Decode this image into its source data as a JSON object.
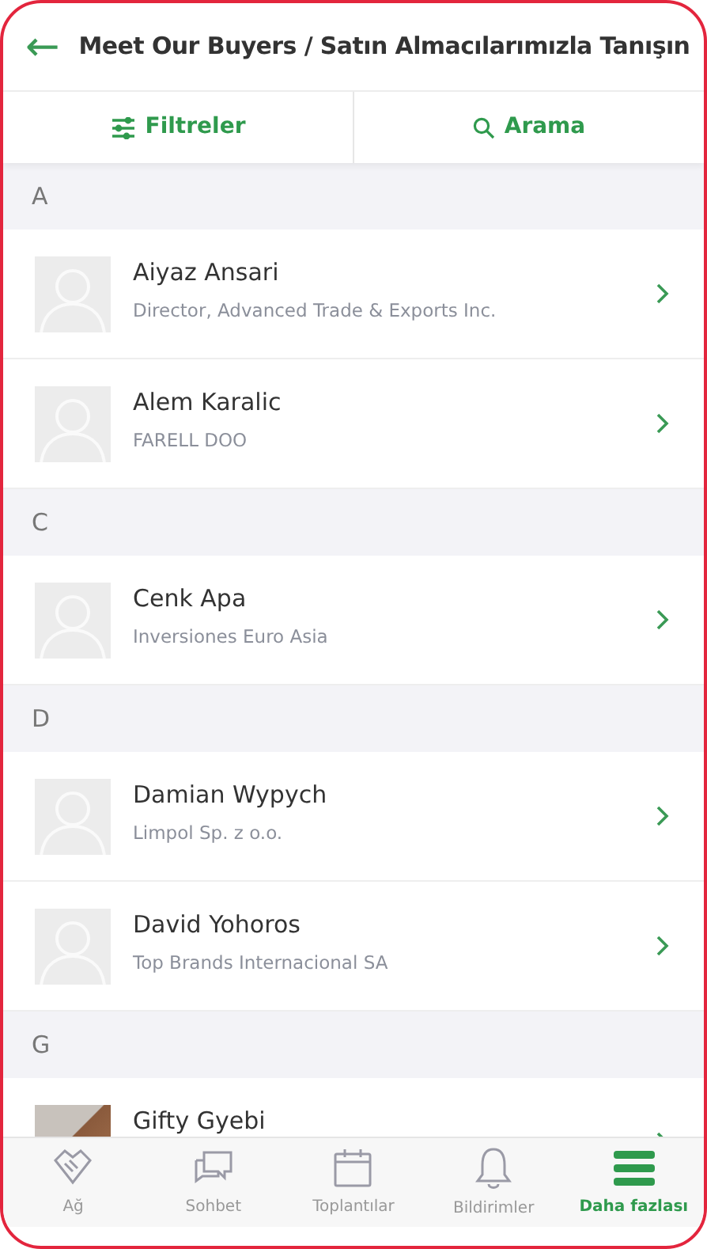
{
  "header": {
    "back": "←",
    "title": "Meet Our Buyers / Satın Almacılarımızla Tanışın"
  },
  "toolbar": [
    {
      "kind": "filter",
      "label": "Filtreler"
    },
    {
      "kind": "search",
      "label": "Arama"
    }
  ],
  "sections": [
    {
      "letter": "A",
      "contacts": [
        {
          "name": "Aiyaz Ansari",
          "subtitle": "Director, Advanced Trade & Exports Inc.",
          "kind": "placeholder"
        },
        {
          "name": "Alem Karalic",
          "subtitle": "FARELL DOO",
          "kind": "placeholder"
        }
      ]
    },
    {
      "letter": "C",
      "contacts": [
        {
          "name": "Cenk Apa",
          "subtitle": "Inversiones Euro Asia",
          "kind": "placeholder"
        }
      ]
    },
    {
      "letter": "D",
      "contacts": [
        {
          "name": "Damian Wypych",
          "subtitle": "Limpol Sp. z o.o.",
          "kind": "placeholder"
        },
        {
          "name": "David Yohoros",
          "subtitle": "Top Brands Internacional SA",
          "kind": "placeholder"
        }
      ]
    },
    {
      "letter": "G",
      "contacts": [
        {
          "name": "Gifty Gyebi",
          "kind": "photo"
        }
      ]
    }
  ],
  "tab_bar": [
    {
      "kind": "network",
      "label": "Ağ",
      "selected": false
    },
    {
      "kind": "chat",
      "label": "Sohbet",
      "selected": false
    },
    {
      "kind": "calendar",
      "label": "Toplantılar",
      "selected": false
    },
    {
      "kind": "bell",
      "label": "Bildirimler",
      "selected": false
    },
    {
      "kind": "menu",
      "label": "Daha fazlası",
      "selected": true
    }
  ]
}
